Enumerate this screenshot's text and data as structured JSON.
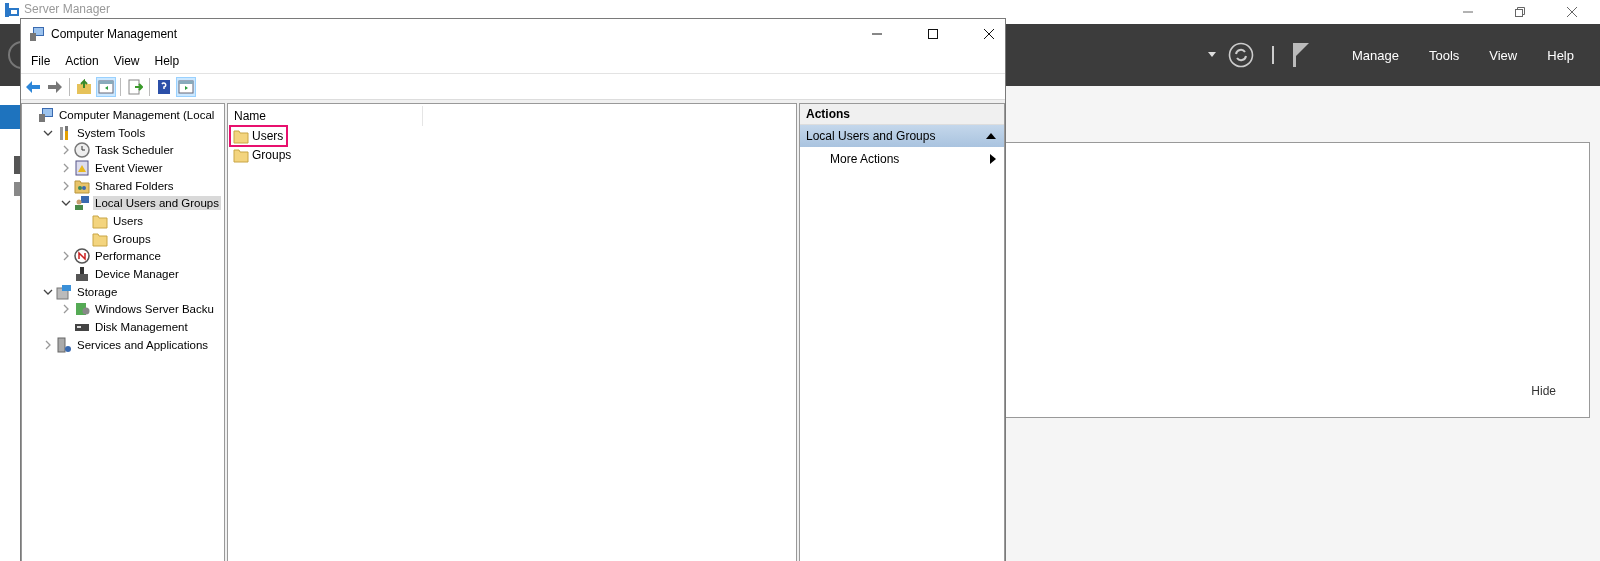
{
  "server_manager": {
    "title": "Server Manager",
    "menu": [
      "Manage",
      "Tools",
      "View",
      "Help"
    ],
    "hide_link": "Hide"
  },
  "window": {
    "title": "Computer Management"
  },
  "menu": [
    "File",
    "Action",
    "View",
    "Help"
  ],
  "toolbar": [
    {
      "pressed": false
    },
    {
      "pressed": false
    },
    {
      "pressed": false
    },
    {
      "pressed": true
    },
    {
      "pressed": false
    },
    {
      "pressed": false
    },
    {
      "pressed": true
    }
  ],
  "tree": [
    {
      "label": "Computer Management (Local",
      "selected": false,
      "children": [
        {
          "label": "System Tools",
          "expanded": true,
          "selected": false,
          "children": [
            {
              "label": "Task Scheduler",
              "expanded": false,
              "selected": false
            },
            {
              "label": "Event Viewer",
              "expanded": false,
              "selected": false
            },
            {
              "label": "Shared Folders",
              "expanded": false,
              "selected": false
            },
            {
              "label": "Local Users and Groups",
              "expanded": true,
              "selected": true,
              "children": [
                {
                  "label": "Users",
                  "selected": false
                },
                {
                  "label": "Groups",
                  "selected": false
                }
              ]
            },
            {
              "label": "Performance",
              "expanded": false,
              "selected": false
            },
            {
              "label": "Device Manager",
              "selected": false
            }
          ]
        },
        {
          "label": "Storage",
          "expanded": true,
          "selected": false,
          "children": [
            {
              "label": "Windows Server Backu",
              "expanded": false,
              "selected": false
            },
            {
              "label": "Disk Management",
              "selected": false
            }
          ]
        },
        {
          "label": "Services and Applications",
          "expanded": false,
          "selected": false
        }
      ]
    }
  ],
  "list": {
    "columns": [
      "Name"
    ],
    "rows": [
      {
        "name": "Users",
        "highlighted": true
      },
      {
        "name": "Groups",
        "highlighted": false
      }
    ]
  },
  "actions": {
    "title": "Actions",
    "sections": [
      {
        "title": "Local Users and Groups",
        "expanded": true,
        "items": [
          "More Actions"
        ]
      }
    ]
  }
}
